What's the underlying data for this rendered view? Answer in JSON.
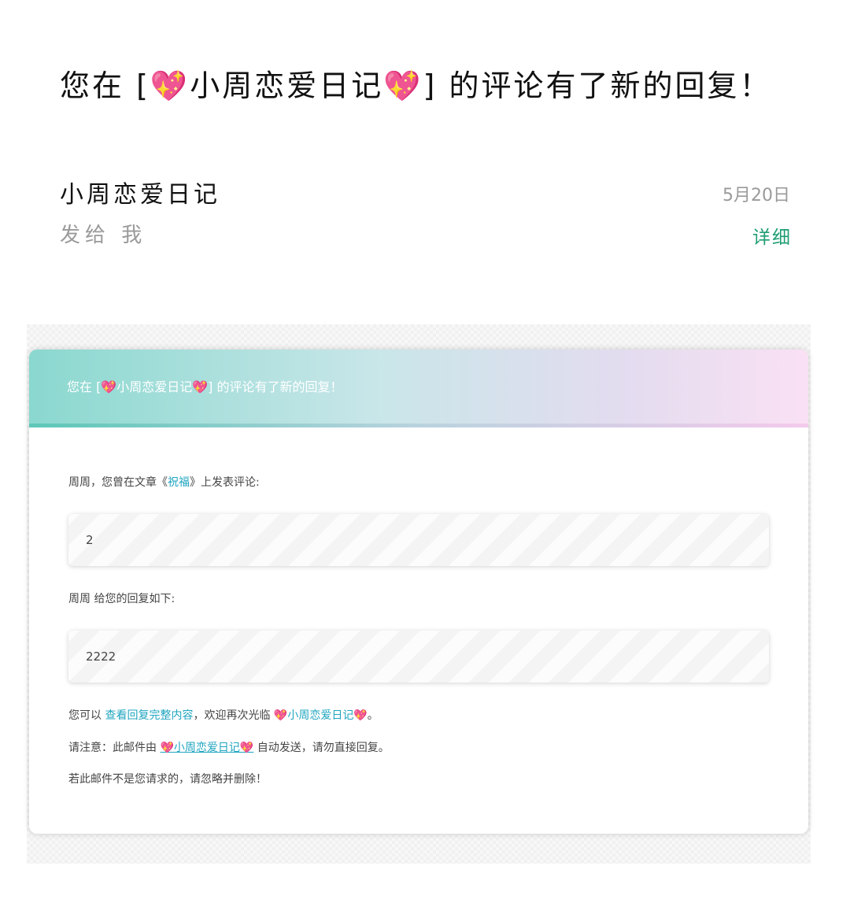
{
  "email": {
    "subject": "您在 [💖小周恋爱日记💖] 的评论有了新的回复！",
    "sender": "小周恋爱日记",
    "recipient": "发给 我",
    "date": "5月20日",
    "detail_label": "详细"
  },
  "card": {
    "header": "您在 [💖小周恋爱日记💖] 的评论有了新的回复！",
    "intro_prefix": "周周，您曾在文章《",
    "article_title": "祝福",
    "intro_suffix": "》上发表评论:",
    "original_comment": "2",
    "reply_intro": "周周 给您的回复如下:",
    "reply_content": "2222",
    "view_prefix": "您可以 ",
    "view_link": "查看回复完整内容",
    "view_middle": "，欢迎再次光临 ",
    "site_link": "💖小周恋爱日记💖",
    "view_suffix": "。",
    "notice_prefix": "请注意：此邮件由 ",
    "notice_link": "💖小周恋爱日记💖",
    "notice_suffix": " 自动发送，请勿直接回复。",
    "disclaimer": "若此邮件不是您请求的，请忽略并删除！"
  },
  "colors": {
    "accent_link": "#20a5c0",
    "detail_green": "#1f9d73",
    "header_gradient_start": "#8ad8cf",
    "header_gradient_end": "#fae0f4"
  }
}
